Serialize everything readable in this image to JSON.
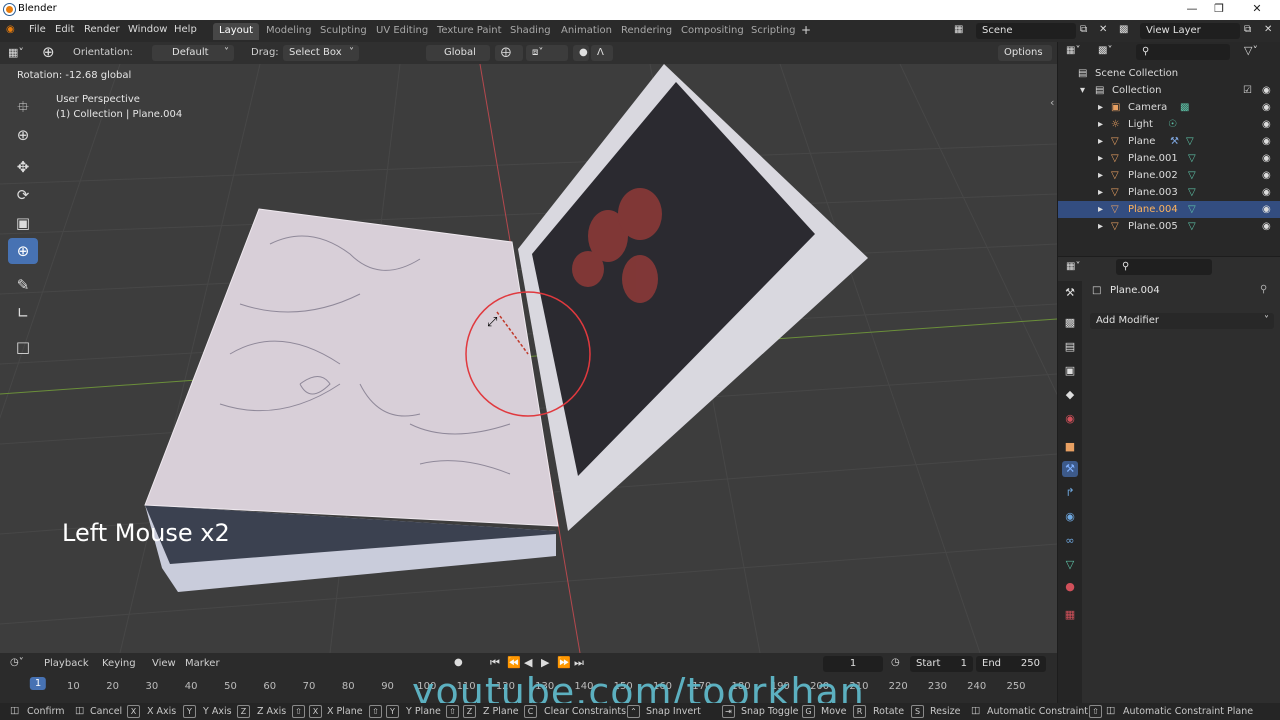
{
  "window": {
    "title": "Blender",
    "min_icon": "minimize-icon",
    "max_icon": "maximize-icon",
    "close_icon": "close-icon"
  },
  "menu": [
    "File",
    "Edit",
    "Render",
    "Window",
    "Help"
  ],
  "workspaces": [
    "Layout",
    "Modeling",
    "Sculpting",
    "UV Editing",
    "Texture Paint",
    "Shading",
    "Animation",
    "Rendering",
    "Compositing",
    "Scripting"
  ],
  "workspace_add": "+",
  "scene": {
    "name": "Scene",
    "view_layer": "View Layer"
  },
  "tool_header": {
    "orientation_label": "Orientation:",
    "orientation_value": "Default",
    "drag_label": "Drag:",
    "drag_value": "Select Box",
    "transform_orientation": "Global",
    "options": "Options"
  },
  "viewport": {
    "operator_info": "Rotation: -12.68 global",
    "view_name": "User Perspective",
    "collection_info": "(1) Collection | Plane.004",
    "overlay_text": "Left Mouse x2",
    "watermark": "youtube.com/toorkhan"
  },
  "outliner": {
    "root": "Scene Collection",
    "collection": "Collection",
    "items": [
      "Camera",
      "Light",
      "Plane",
      "Plane.001",
      "Plane.002",
      "Plane.003",
      "Plane.004",
      "Plane.005"
    ],
    "selected": "Plane.004"
  },
  "properties": {
    "object_name": "Plane.004",
    "add_modifier": "Add Modifier"
  },
  "timeline": {
    "menus": [
      "Playback",
      "Keying",
      "View",
      "Marker"
    ],
    "current_frame": "1",
    "start_label": "Start",
    "start_value": "1",
    "end_label": "End",
    "end_value": "250",
    "ticks": [
      "1",
      "10",
      "20",
      "30",
      "40",
      "50",
      "60",
      "70",
      "80",
      "90",
      "100",
      "110",
      "120",
      "130",
      "140",
      "150",
      "160",
      "170",
      "180",
      "190",
      "200",
      "210",
      "220",
      "230",
      "240",
      "250"
    ]
  },
  "status": {
    "confirm": "Confirm",
    "cancel": "Cancel",
    "x_axis": "X Axis",
    "y_axis": "Y Axis",
    "z_axis": "Z Axis",
    "x_plane": "X Plane",
    "y_plane": "Y Plane",
    "z_plane": "Z Plane",
    "clear_constraints": "Clear Constraints",
    "snap_invert": "Snap Invert",
    "snap_toggle": "Snap Toggle",
    "move": "Move",
    "rotate": "Rotate",
    "resize": "Resize",
    "auto_constraint": "Automatic Constraint",
    "auto_constraint_plane": "Automatic Constraint Plane"
  }
}
